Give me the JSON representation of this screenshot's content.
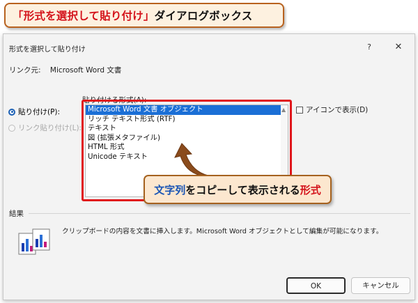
{
  "banner": {
    "title_quoted": "「形式を選択して貼り付け」",
    "title_suffix": "ダイアログボックス"
  },
  "dialog": {
    "title": "形式を選択して貼り付け",
    "help_label": "?",
    "close_label": "✕",
    "link_source_label": "リンク元:",
    "link_source_value": "Microsoft Word 文書",
    "radio_paste": "貼り付け(P):",
    "radio_paste_link": "リンク貼り付け(L):",
    "format_label": "貼り付ける形式(A):",
    "formats": [
      "Microsoft Word 文書 オブジェクト",
      "リッチ テキスト形式 (RTF)",
      "テキスト",
      "図 (拡張メタファイル)",
      "HTML 形式",
      "Unicode テキスト"
    ],
    "selected_format_index": 0,
    "show_as_icon": "アイコンで表示(D)",
    "result_label": "結果",
    "result_text": "クリップボードの内容を文書に挿入します。Microsoft Word オブジェクトとして編集が可能になります。",
    "ok_label": "OK",
    "cancel_label": "キャンセル"
  },
  "callout": {
    "part1": "文字列",
    "part2": "をコピーして表示される",
    "part3": "形式"
  },
  "colors": {
    "highlight_red": "#e0161b",
    "selection_blue": "#1b6fd6",
    "callout_fill": "#fce7cf"
  }
}
